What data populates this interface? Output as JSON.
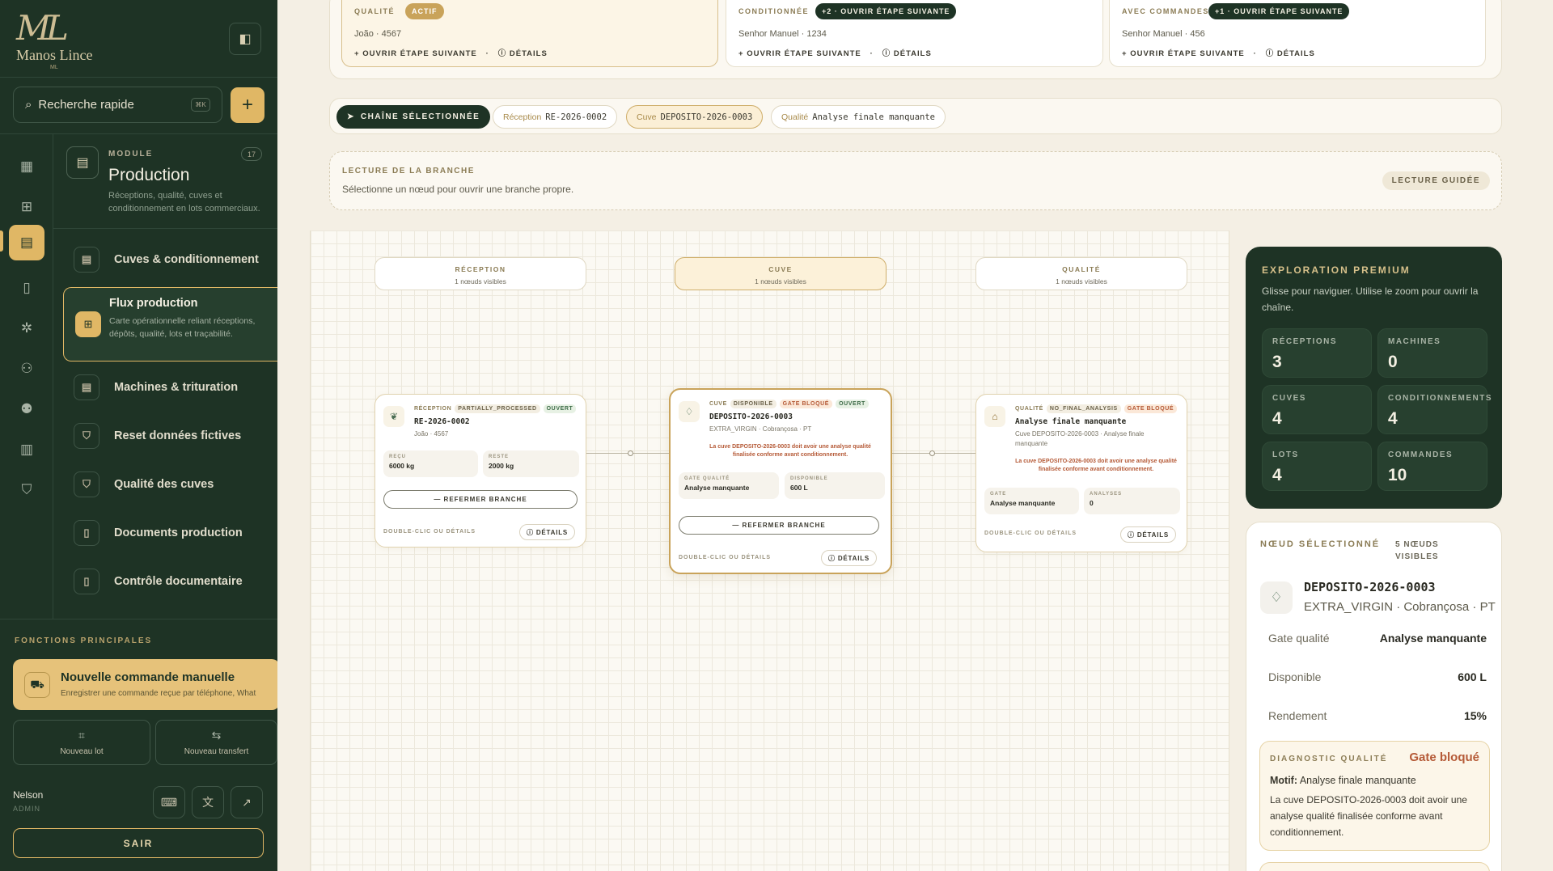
{
  "sidebar": {
    "logo": {
      "monogram": "ML",
      "name": "Manos Lince",
      "mark": "ML"
    },
    "search": {
      "label": "Recherche rapide",
      "shortcut": "⌘K"
    },
    "module": {
      "kicker": "MODULE",
      "count": "17",
      "title": "Production",
      "description": "Réceptions, qualité, cuves et conditionnement en lots commerciaux."
    },
    "nav": [
      {
        "label": "Cuves & conditionnement"
      },
      {
        "label": "Flux production",
        "description": "Carte opérationnelle reliant réceptions, dépôts, qualité, lots et traçabilité."
      },
      {
        "label": "Machines & trituration"
      },
      {
        "label": "Reset données fictives"
      },
      {
        "label": "Qualité des cuves"
      },
      {
        "label": "Documents production"
      },
      {
        "label": "Contrôle documentaire"
      }
    ],
    "functions_label": "FONCTIONS PRINCIPALES",
    "new_order": {
      "title": "Nouvelle commande manuelle",
      "description": "Enregistrer une commande reçue par téléphone, What"
    },
    "new_lot": "Nouveau lot",
    "new_transfer": "Nouveau transfert",
    "user": {
      "name": "Nelson",
      "role": "ADMIN"
    },
    "logout": "SAIR"
  },
  "pipeline": [
    {
      "kicker": "QUALITÉ",
      "badge": "ACTIF",
      "who": "João · 4567",
      "open": "OUVRIR ÉTAPE SUIVANTE",
      "details": "DÉTAILS"
    },
    {
      "kicker": "CONDITIONNÉE",
      "badge": "+2 · OUVRIR ÉTAPE SUIVANTE",
      "who": "Senhor Manuel · 1234",
      "open": "OUVRIR ÉTAPE SUIVANTE",
      "details": "DÉTAILS"
    },
    {
      "kicker": "AVEC COMMANDES",
      "badge": "+1 · OUVRIR ÉTAPE SUIVANTE",
      "who": "Senhor Manuel · 456",
      "open": "OUVRIR ÉTAPE SUIVANTE",
      "details": "DÉTAILS"
    }
  ],
  "chain": {
    "selected": "CHAÎNE SÉLECTIONNÉE",
    "chips": [
      {
        "label": "Réception",
        "value": "RE-2026-0002"
      },
      {
        "label": "Cuve",
        "value": "DEPOSITO-2026-0003"
      },
      {
        "label": "Qualité",
        "value": "Analyse finale manquante"
      }
    ]
  },
  "branch": {
    "kicker": "LECTURE DE LA BRANCHE",
    "description": "Sélectionne un nœud pour ouvrir une branche propre.",
    "guide": "LECTURE GUIDÉE"
  },
  "columns": [
    {
      "title": "RÉCEPTION",
      "sub": "1 nœuds visibles"
    },
    {
      "title": "CUVE",
      "sub": "1 nœuds visibles"
    },
    {
      "title": "QUALITÉ",
      "sub": "1 nœuds visibles"
    }
  ],
  "nodes": {
    "reception": {
      "kind": "RÉCEPTION",
      "status": "PARTIALLY_PROCESSED",
      "state": "OUVERT",
      "title": "RE-2026-0002",
      "sub": "João · 4567",
      "stat1_k": "REÇU",
      "stat1_v": "6000 kg",
      "stat2_k": "RESTE",
      "stat2_v": "2000 kg",
      "close": "— REFERMER BRANCHE",
      "foot": "DOUBLE-CLIC OU DÉTAILS",
      "details": "DÉTAILS"
    },
    "cuve": {
      "kind": "CUVE",
      "status": "DISPONIBLE",
      "gate": "GATE BLOQUÉ",
      "state": "OUVERT",
      "title": "DEPOSITO-2026-0003",
      "sub": "EXTRA_VIRGIN · Cobrançosa · PT",
      "warn": "La cuve DEPOSITO-2026-0003 doit avoir une analyse qualité finalisée conforme avant conditionnement.",
      "stat1_k": "GATE QUALITÉ",
      "stat1_v": "Analyse manquante",
      "stat2_k": "DISPONIBLE",
      "stat2_v": "600 L",
      "close": "— REFERMER BRANCHE",
      "foot": "DOUBLE-CLIC OU DÉTAILS",
      "details": "DÉTAILS"
    },
    "qualite": {
      "kind": "QUALITÉ",
      "status": "NO_FINAL_ANALYSIS",
      "gate": "GATE BLOQUÉ",
      "title": "Analyse finale manquante",
      "sub": "Cuve DEPOSITO-2026-0003 · Analyse finale manquante",
      "warn": "La cuve DEPOSITO-2026-0003 doit avoir une analyse qualité finalisée conforme avant conditionnement.",
      "stat1_k": "GATE",
      "stat1_v": "Analyse manquante",
      "stat2_k": "ANALYSES",
      "stat2_v": "0",
      "foot": "DOUBLE-CLIC OU DÉTAILS",
      "details": "DÉTAILS"
    }
  },
  "premium": {
    "title": "EXPLORATION PREMIUM",
    "description": "Glisse pour naviguer. Utilise le zoom pour ouvrir la chaîne.",
    "tiles": [
      {
        "label": "RÉCEPTIONS",
        "value": "3"
      },
      {
        "label": "MACHINES",
        "value": "0"
      },
      {
        "label": "CUVES",
        "value": "4"
      },
      {
        "label": "CONDITIONNEMENTS",
        "value": "4"
      },
      {
        "label": "LOTS",
        "value": "4"
      },
      {
        "label": "COMMANDES",
        "value": "10"
      }
    ]
  },
  "selected_node": {
    "kicker": "NŒUD SÉLECTIONNÉ",
    "count": "5 NŒUDS VISIBLES",
    "title": "DEPOSITO-2026-0003",
    "sub": "EXTRA_VIRGIN · Cobrançosa · PT",
    "rows": [
      {
        "label": "Gate qualité",
        "value": "Analyse manquante"
      },
      {
        "label": "Disponible",
        "value": "600 L"
      },
      {
        "label": "Rendement",
        "value": "15%"
      }
    ],
    "diagnostic": {
      "kicker": "DIAGNOSTIC QUALITÉ",
      "status": "Gate bloqué",
      "motif_label": "Motif:",
      "motif": "Analyse finale manquante",
      "description": "La cuve DEPOSITO-2026-0003 doit avoir une analyse qualité finalisée conforme avant conditionnement."
    }
  },
  "colors": {
    "forest": "#1e3325",
    "gold": "#e0b765",
    "blocked": "#b55a37"
  }
}
